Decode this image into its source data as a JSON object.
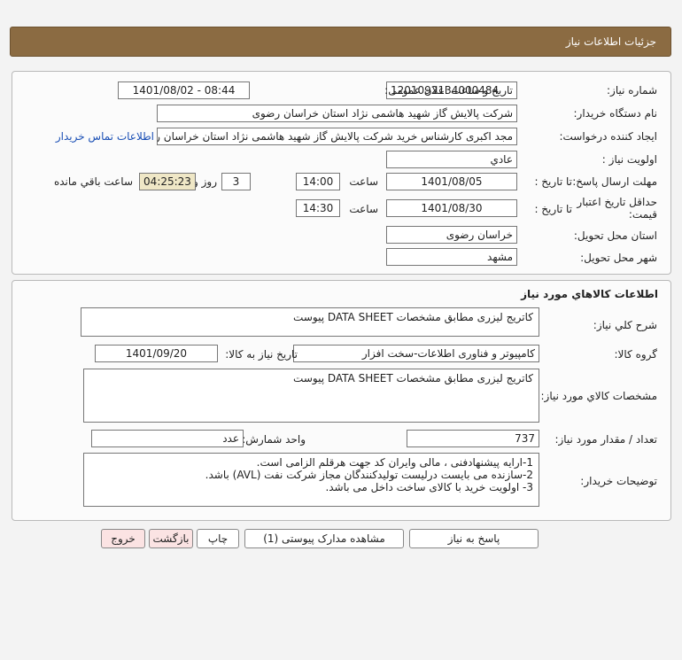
{
  "header": {
    "title": "جزئیات اطلاعات نیاز"
  },
  "info": {
    "need_number_label": "شماره نیاز:",
    "need_number": "1201092134000484",
    "announce_label": "تاریخ و ساعت اعلان عمومی:",
    "announce_value": "1401/08/02 - 08:44",
    "buyer_org_label": "نام دستگاه خریدار:",
    "buyer_org": "شرکت پالایش گاز شهید هاشمی نژاد   استان خراسان رضوی",
    "requester_label": "ایجاد کننده درخواست:",
    "requester": "مجد اکبری کارشناس خرید شرکت پالایش گاز شهید هاشمی نژاد   استان خراسان رضوی",
    "contact_link": "اطلاعات تماس خریدار",
    "priority_label": "اولویت نیاز :",
    "priority": "عادي",
    "send_deadline_label": "مهلت ارسال پاسخ:",
    "to_date_label": "تا تاریخ :",
    "send_date": "1401/08/05",
    "time_label": "ساعت",
    "send_time": "14:00",
    "days": "3",
    "days_label": "روز و",
    "remaining_time": "04:25:23",
    "remaining_label": "ساعت باقي مانده",
    "validity_label_1": "حداقل تاریخ اعتبار",
    "validity_label_2": "قیمت:",
    "validity_date": "1401/08/30",
    "validity_time": "14:30",
    "province_label": "استان محل تحویل:",
    "province": "خراسان رضوی",
    "city_label": "شهر محل تحویل:",
    "city": "مشهد"
  },
  "goods": {
    "section_title": "اطلاعات کالاهاي مورد نياز",
    "general_desc_label": "شرح کلي نياز:",
    "general_desc": "کاتریج لیزری مطابق مشخصات DATA SHEET پیوست",
    "group_label": "گروه کالا:",
    "group": "کامپیوتر و فناوری اطلاعات-سخت افزار",
    "need_date_label": "تاریخ نیاز به کالا:",
    "need_date": "1401/09/20",
    "spec_label": "مشخصات کالاي مورد نياز:",
    "spec": "کاتریج لیزری مطابق مشخصات DATA SHEET پیوست",
    "qty_label": "تعداد / مقدار مورد نیاز:",
    "qty": "737",
    "unit_label": "واحد شمارش:",
    "unit": "عدد",
    "buyer_notes_label": "توضیحات خریدار:",
    "buyer_notes": [
      "1-ارایه پیشنهادفنی ، مالی وایران کد جهت هرقلم الزامی است.",
      "2-سازنده می بایست درلیست تولیدکنندگان مجاز شرکت نفت (AVL)  باشد.",
      "3- اولویت خرید  با کالای ساخت  داخل می باشد."
    ]
  },
  "buttons": {
    "reply": "پاسخ به نیاز",
    "view_docs": "مشاهده مدارک پیوستی (1)",
    "print": "چاپ",
    "back": "بازگشت",
    "exit": "خروج"
  }
}
